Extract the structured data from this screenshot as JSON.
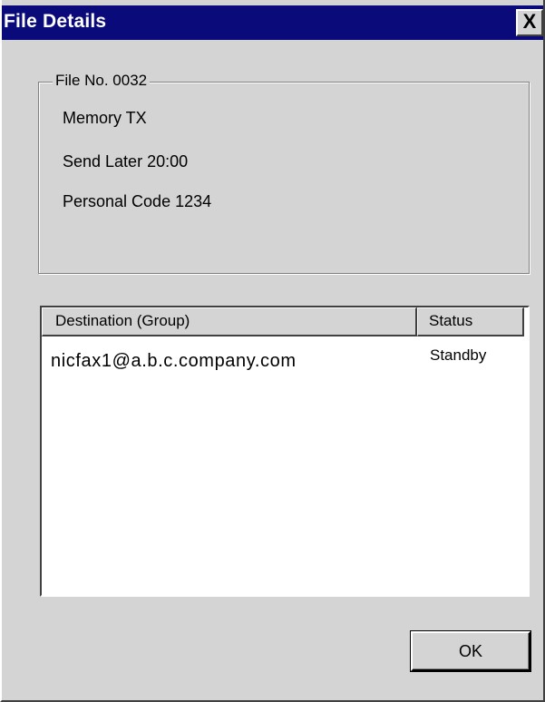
{
  "window": {
    "title": "File Details",
    "close_glyph": "X"
  },
  "file_info": {
    "group_label": "File No. 0032",
    "lines": [
      "Memory TX",
      "Send Later 20:00",
      "Personal Code 1234"
    ]
  },
  "destinations": {
    "columns": [
      "Destination (Group)",
      "Status"
    ],
    "rows": [
      {
        "destination": "nicfax1@a.b.c.company.com",
        "status": "Standby"
      }
    ]
  },
  "buttons": {
    "ok_label": "OK"
  },
  "colors": {
    "title_bar": "#0a0a7a",
    "dialog_face": "#d4d4d4"
  }
}
